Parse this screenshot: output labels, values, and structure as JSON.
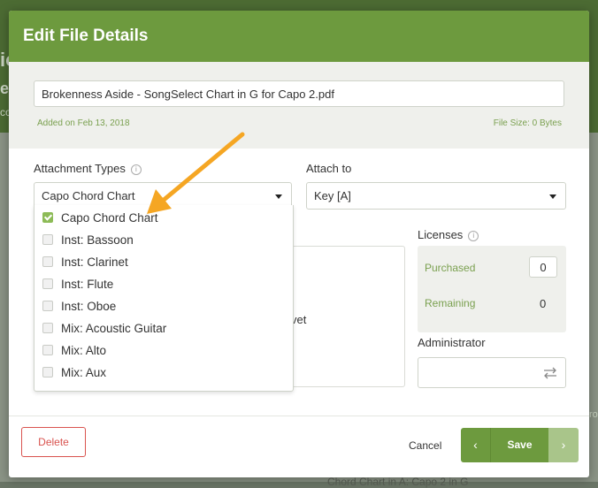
{
  "modal": {
    "title": "Edit File Details",
    "file_name": "Brokenness Aside - SongSelect Chart in G for Capo 2.pdf",
    "added_on": "Added on Feb 13, 2018",
    "file_size": "File Size: 0 Bytes"
  },
  "attachment_types": {
    "label": "Attachment Types",
    "info_glyph": "i",
    "selected": "Capo Chord Chart",
    "options": [
      {
        "label": "Capo Chord Chart",
        "checked": true
      },
      {
        "label": "Inst: Bassoon",
        "checked": false
      },
      {
        "label": "Inst: Clarinet",
        "checked": false
      },
      {
        "label": "Inst: Flute",
        "checked": false
      },
      {
        "label": "Inst: Oboe",
        "checked": false
      },
      {
        "label": "Mix: Acoustic Guitar",
        "checked": false
      },
      {
        "label": "Mix: Alto",
        "checked": false
      },
      {
        "label": "Mix: Aux",
        "checked": false
      }
    ]
  },
  "attach_to": {
    "label": "Attach to",
    "selected": "Key [A]"
  },
  "partial_text": "vet",
  "licenses": {
    "label": "Licenses",
    "info_glyph": "i",
    "purchased_label": "Purchased",
    "purchased_value": "0",
    "remaining_label": "Remaining",
    "remaining_value": "0"
  },
  "administrator": {
    "label": "Administrator",
    "value": ""
  },
  "footer": {
    "delete_label": "Delete",
    "cancel_label": "Cancel",
    "save_label": "Save",
    "prev_glyph": "‹",
    "next_glyph": "›"
  },
  "background": {
    "fragment_1": "ic",
    "fragment_2": "e",
    "fragment_3": "co",
    "fragment_4": "Chord Chart in A: Capo 2 in G",
    "fragment_5": "ro"
  },
  "colors": {
    "header_green": "#6d9a3e",
    "label_green": "#7aa04f",
    "delete_red": "#d9534f",
    "annotation_arrow": "#f5a623"
  }
}
